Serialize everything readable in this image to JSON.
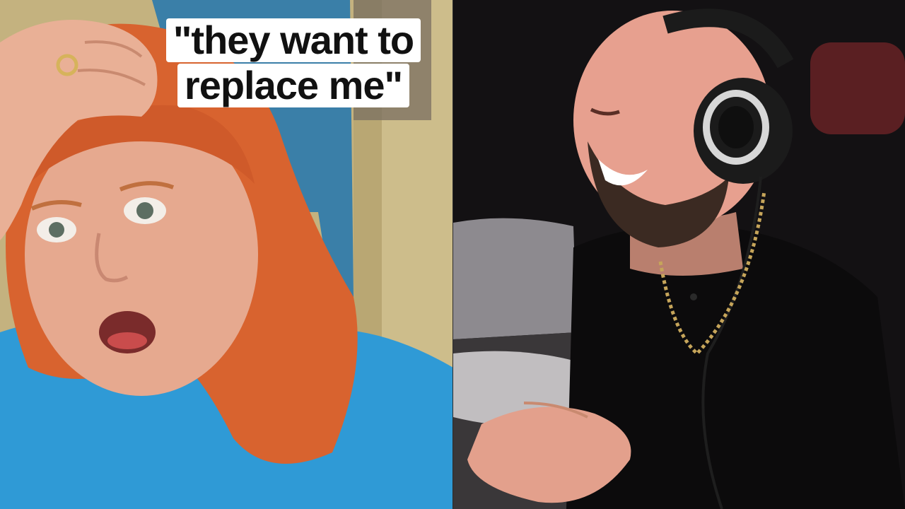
{
  "caption": {
    "line1": "\"they want to",
    "line2": "replace me\""
  },
  "colors": {
    "left_wall": "#c9b98a",
    "towel": "#3a7fa8",
    "hair": "#d8632f",
    "skin_left": "#e6a98f",
    "shirt": "#2f9ad6",
    "right_bg": "#141214",
    "skin_right": "#e7a08f",
    "beard": "#3b2a22",
    "headphones": "#1b1b1b",
    "chain": "#c6a55a",
    "caption_bg": "#ffffff",
    "caption_text": "#111111"
  },
  "scene": {
    "left": "woman-shocked-hand-on-head",
    "right": "man-laughing-with-headphones"
  }
}
